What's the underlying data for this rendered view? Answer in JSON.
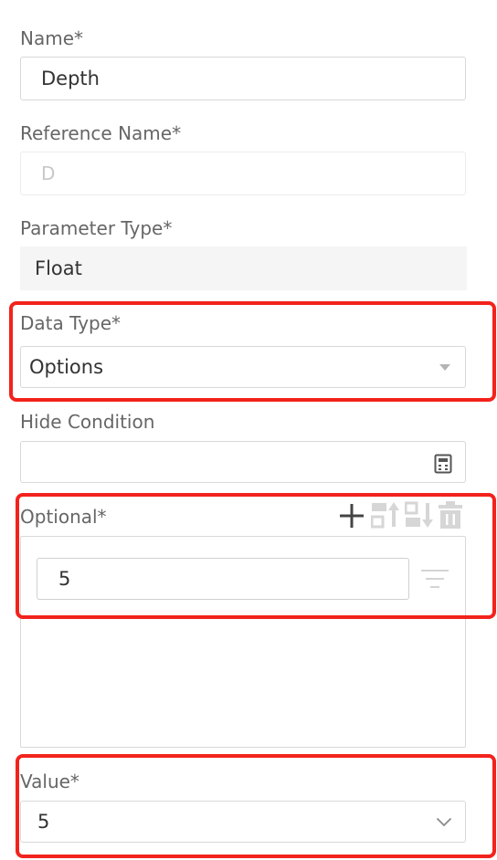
{
  "form": {
    "name": {
      "label": "Name*",
      "value": "Depth"
    },
    "reference_name": {
      "label": "Reference Name*",
      "placeholder": "D"
    },
    "parameter_type": {
      "label": "Parameter Type*",
      "value": "Float"
    },
    "data_type": {
      "label": "Data Type*",
      "value": "Options"
    },
    "hide_condition": {
      "label": "Hide Condition",
      "value": ""
    },
    "optional": {
      "label": "Optional*",
      "options": [
        "5"
      ],
      "toolbar_icons": [
        "plus-icon",
        "move-up-icon",
        "move-down-icon",
        "delete-icon"
      ]
    },
    "value": {
      "label": "Value*",
      "selected": "5"
    }
  },
  "colors": {
    "highlight": "#f2231c",
    "label": "#666666",
    "border": "#d8d8d8",
    "readonly_bg": "#f5f5f5"
  },
  "icons": {
    "calculator": "calculator-icon",
    "filter": "filter-icon",
    "dropdown_caret": "caret-down-icon",
    "chevron": "chevron-down-icon"
  }
}
